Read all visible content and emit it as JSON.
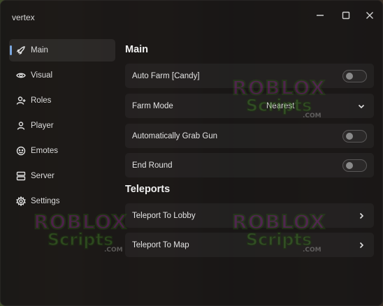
{
  "app": {
    "title": "vertex"
  },
  "window_controls": [
    {
      "name": "minimize-button",
      "icon": "minimize-icon"
    },
    {
      "name": "maximize-button",
      "icon": "maximize-icon"
    },
    {
      "name": "close-button",
      "icon": "close-icon"
    }
  ],
  "sidebar": {
    "items": [
      {
        "label": "Main",
        "icon": "rocket-icon",
        "active": true
      },
      {
        "label": "Visual",
        "icon": "eye-icon",
        "active": false
      },
      {
        "label": "Roles",
        "icon": "user-plus-icon",
        "active": false
      },
      {
        "label": "Player",
        "icon": "user-icon",
        "active": false
      },
      {
        "label": "Emotes",
        "icon": "emote-icon",
        "active": false
      },
      {
        "label": "Server",
        "icon": "server-icon",
        "active": false
      },
      {
        "label": "Settings",
        "icon": "gear-icon",
        "active": false
      }
    ]
  },
  "main": {
    "title": "Main",
    "auto_farm": {
      "label": "Auto Farm [Candy]",
      "enabled": false
    },
    "farm_mode": {
      "label": "Farm Mode",
      "value": "Nearest"
    },
    "grab_gun": {
      "label": "Automatically Grab Gun",
      "enabled": false
    },
    "end_round": {
      "label": "End Round",
      "enabled": false
    }
  },
  "teleports": {
    "title": "Teleports",
    "lobby": {
      "label": "Teleport To Lobby"
    },
    "map": {
      "label": "Teleport To Map"
    }
  },
  "watermark": {
    "line1": "ROBLOX",
    "line2": "Scripts",
    "line3": ".COM"
  },
  "colors": {
    "accent": "#7aa7e0",
    "window_bg": "#181616",
    "row_bg": "#262424"
  }
}
